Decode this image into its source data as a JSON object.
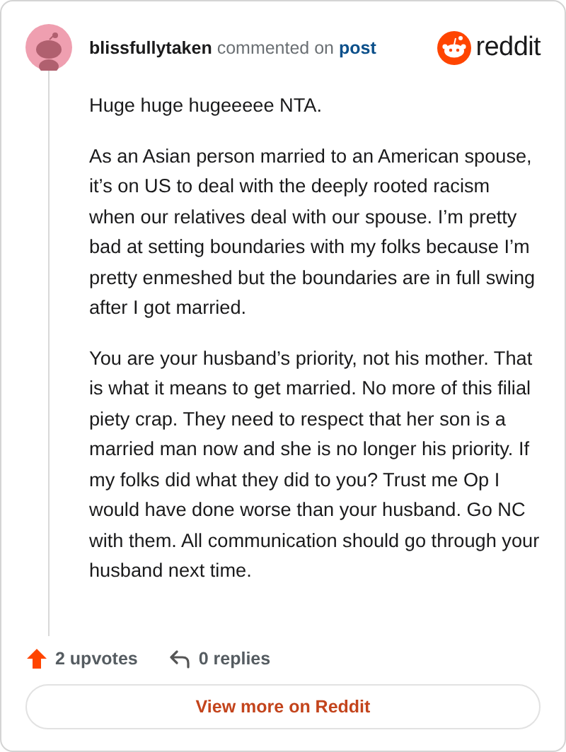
{
  "header": {
    "username": "blissfullytaken",
    "action": "commented on",
    "link": "post",
    "brand": "reddit"
  },
  "paragraphs": [
    "Huge huge hugeeeee NTA.",
    "As an Asian person married to an American spouse, it’s on US to deal with the deeply rooted racism when our relatives deal with our spouse. I’m pretty bad at setting boundaries with my folks because I’m pretty enmeshed but the boundaries are in full swing after I got married.",
    "You are your husband’s priority, not his mother. That is what it means to get married. No more of this filial piety crap. They need to respect that her son is a married man now and she is no longer his priority. If my folks did what they did to you? Trust me Op I would have done worse than your husband. Go NC with them. All communication should go through your husband next time."
  ],
  "footer": {
    "upvotes": "2 upvotes",
    "replies": "0 replies",
    "button": "View more on Reddit"
  }
}
